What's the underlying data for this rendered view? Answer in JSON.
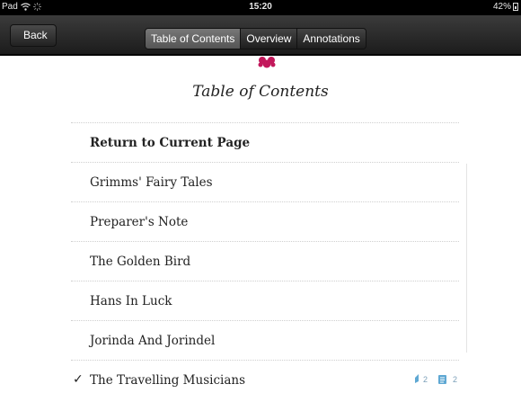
{
  "status_bar": {
    "device": "Pad",
    "time": "15:20",
    "battery": "42%"
  },
  "nav": {
    "back_label": "Back",
    "tabs": [
      {
        "label": "Table of Contents",
        "active": true
      },
      {
        "label": "Overview",
        "active": false
      },
      {
        "label": "Annotations",
        "active": false
      }
    ]
  },
  "page": {
    "title": "Table of Contents",
    "toc_items": [
      {
        "label": "Return to Current Page",
        "bold": true,
        "checked": false
      },
      {
        "label": "Grimms' Fairy Tales",
        "bold": false,
        "checked": false
      },
      {
        "label": "Preparer's Note",
        "bold": false,
        "checked": false
      },
      {
        "label": "The Golden Bird",
        "bold": false,
        "checked": false
      },
      {
        "label": "Hans In Luck",
        "bold": false,
        "checked": false
      },
      {
        "label": "Jorinda And Jorindel",
        "bold": false,
        "checked": false
      },
      {
        "label": "The Travelling Musicians",
        "bold": false,
        "checked": true,
        "highlights": "2",
        "notes": "2"
      }
    ]
  },
  "colors": {
    "ornament": "#c2185b",
    "annotation": "#5fa8d3"
  }
}
